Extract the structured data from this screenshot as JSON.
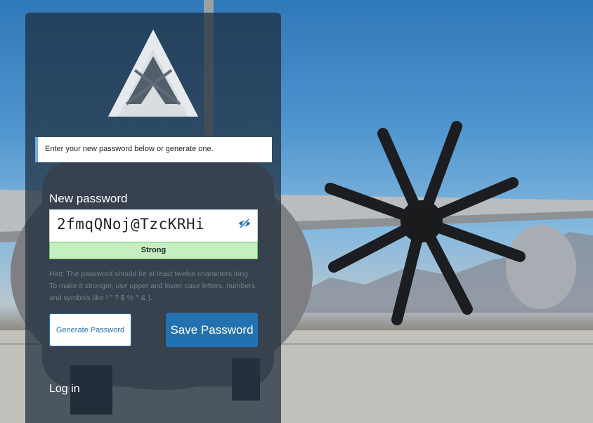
{
  "message": "Enter your new password below or generate one.",
  "form": {
    "new_password_label": "New password",
    "password_value": "2fmqQNoj@TzcKRHi",
    "strength_label": "Strong",
    "hint": "Hint: The password should be at least twelve characters long. To make it stronger, use upper and lower case letters, numbers, and symbols like ! \" ? $ % ^ & ).",
    "generate_button": "Generate Password",
    "save_button": "Save Password"
  },
  "footer": {
    "login_link": "Log in"
  },
  "colors": {
    "accent": "#2271b1",
    "strong": "#c6efc0",
    "message_border": "#72aee6"
  },
  "icons": {
    "logo": "triangle-x-logo",
    "toggle": "eye-slash-icon"
  }
}
